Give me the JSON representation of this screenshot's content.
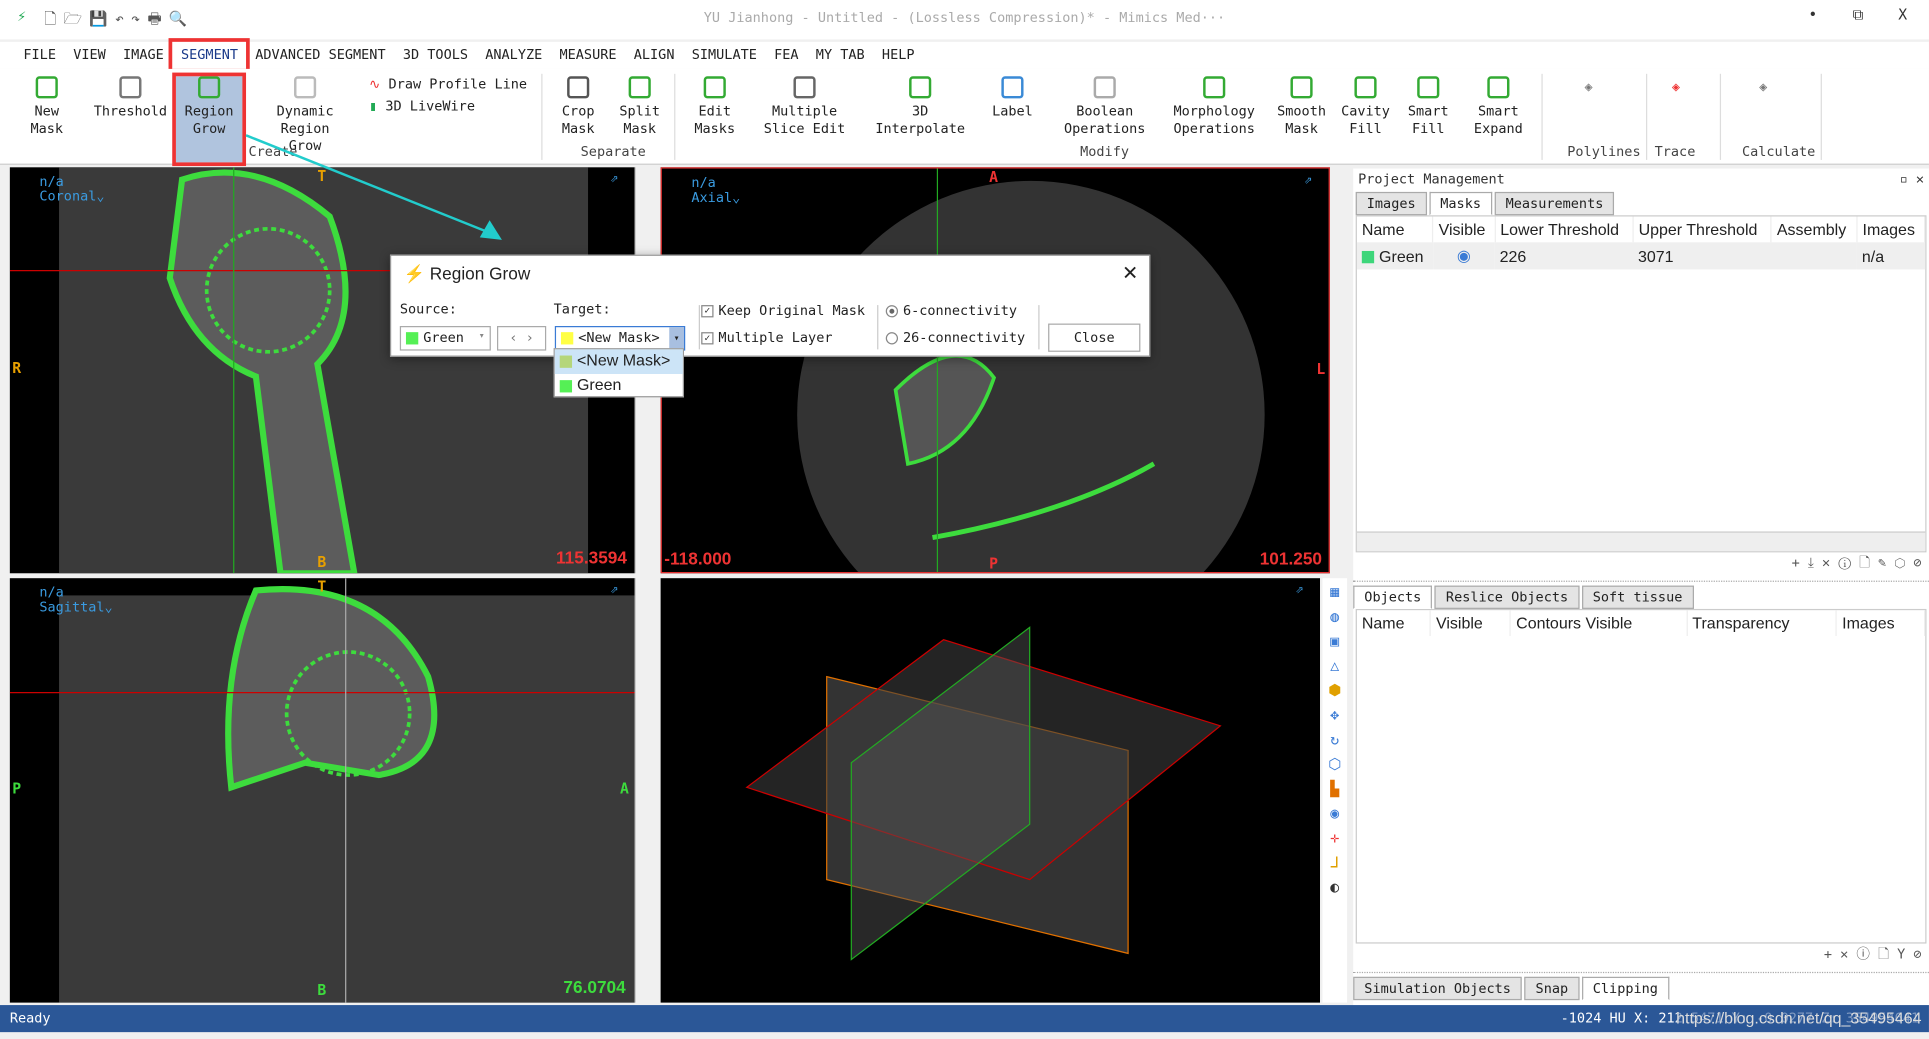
{
  "window": {
    "title": "YU Jianhong - Untitled -  (Lossless Compression)* - Mimics Med···",
    "minimize": "•",
    "restore": "⧉",
    "close": "X"
  },
  "menu": [
    "FILE",
    "VIEW",
    "IMAGE",
    "SEGMENT",
    "ADVANCED SEGMENT",
    "3D TOOLS",
    "ANALYZE",
    "MEASURE",
    "ALIGN",
    "SIMULATE",
    "FEA",
    "MY TAB",
    "HELP"
  ],
  "ribbon": {
    "buttons": [
      {
        "l1": "New",
        "l2": "Mask"
      },
      {
        "l1": "Threshold",
        "l2": ""
      },
      {
        "l1": "Region",
        "l2": "Grow"
      },
      {
        "l1": "Dynamic Region",
        "l2": "Grow"
      },
      {
        "l1": "Crop",
        "l2": "Mask"
      },
      {
        "l1": "Split",
        "l2": "Mask"
      },
      {
        "l1": "Edit",
        "l2": "Masks"
      },
      {
        "l1": "Multiple",
        "l2": "Slice Edit"
      },
      {
        "l1": "3D Interpolate",
        "l2": ""
      },
      {
        "l1": "Label",
        "l2": ""
      },
      {
        "l1": "Boolean",
        "l2": "Operations"
      },
      {
        "l1": "Morphology",
        "l2": "Operations"
      },
      {
        "l1": "Smooth",
        "l2": "Mask"
      },
      {
        "l1": "Cavity",
        "l2": "Fill"
      },
      {
        "l1": "Smart",
        "l2": "Fill"
      },
      {
        "l1": "Smart",
        "l2": "Expand"
      }
    ],
    "small": [
      "Draw Profile Line",
      "3D LiveWire"
    ],
    "groups": [
      "Create",
      "Separate",
      "Modify",
      "Polylines",
      "Trace",
      "Calculate"
    ]
  },
  "viewports": {
    "coronal": {
      "top": "n/a",
      "name": "Coronal",
      "T": "T",
      "B": "B",
      "R": "R",
      "value": "115.3594"
    },
    "axial": {
      "top": "n/a",
      "name": "Axial",
      "A": "A",
      "P": "P",
      "L": "L",
      "value_left": "-118.000",
      "value": "101.250"
    },
    "sagittal": {
      "top": "n/a",
      "name": "Sagittal",
      "T": "T",
      "B": "B",
      "P": "P",
      "A": "A",
      "value": "76.0704"
    }
  },
  "dialog": {
    "title": "Region Grow",
    "source_label": "Source:",
    "source_value": "Green",
    "target_label": "Target:",
    "target_value": "<New Mask>",
    "options": [
      "<New Mask>",
      "Green"
    ],
    "keep_original": "Keep Original Mask",
    "multiple_layer": "Multiple Layer",
    "conn6": "6-connectivity",
    "conn26": "26-connectivity",
    "close": "Close",
    "nav": "‹ ›"
  },
  "project": {
    "title": "Project Management",
    "tabs": [
      "Images",
      "Masks",
      "Measurements"
    ],
    "columns": [
      "Name",
      "Visible",
      "Lower Threshold",
      "Upper Threshold",
      "Assembly",
      "Images"
    ],
    "rows": [
      {
        "name": "Green",
        "color": "#3dd67a",
        "lower": "226",
        "upper": "3071",
        "assembly": "",
        "images": "n/a"
      }
    ]
  },
  "objects": {
    "tabs": [
      "Objects",
      "Reslice Objects",
      "Soft tissue"
    ],
    "columns": [
      "Name",
      "Visible",
      "Contours Visible",
      "Transparency",
      "Images"
    ]
  },
  "bottom_tabs": [
    "Simulation Objects",
    "Snap",
    "Clipping"
  ],
  "status": {
    "left": "Ready",
    "right": "-1024 HU X: 212.5471 Y: -0.0277 Z: 354954641",
    "watermark": "https://blog.csdn.net/qq_35495464"
  },
  "colors": {
    "mask_green": "#3ddc3d",
    "new_mask_yellow": "#ffff44",
    "highlight": "#e33333",
    "status_bar": "#2b5797"
  }
}
